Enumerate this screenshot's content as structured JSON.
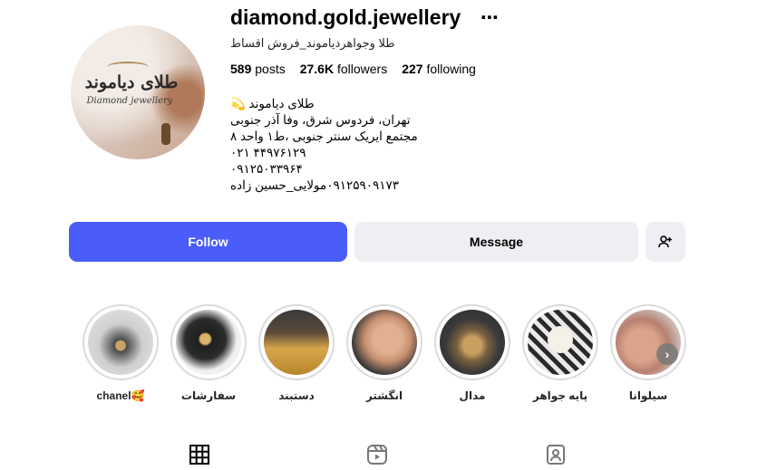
{
  "profile": {
    "username": "diamond.gold.jewellery",
    "more_icon": "⋯",
    "full_name": "طلا وجواهردیاموند_فروش اقساط",
    "avatar": {
      "logo_text": "طلای دیاموند",
      "logo_sub": "Diamond jewellery"
    },
    "stats": {
      "posts_value": "589",
      "posts_label": "posts",
      "followers_value": "27.6K",
      "followers_label": "followers",
      "following_value": "227",
      "following_label": "following"
    },
    "bio": [
      "طلای دیاموند 💫",
      "تهران، فردوس شرق، وفا آذر جنوبی",
      "مجتمع ایریک سنتر جنوبی ،ط۱ واحد ۸",
      "۰۲۱ ۴۴۹۷۶۱۲۹",
      "۰۹۱۲۵۰۳۳۹۶۴",
      "۰۹۱۲۵۹۰۹۱۷۳مولایی_حسین زاده"
    ]
  },
  "actions": {
    "follow_label": "Follow",
    "message_label": "Message",
    "add_icon": "person-plus-icon"
  },
  "highlights": [
    {
      "label": "chanel🥰"
    },
    {
      "label": "سفارشات"
    },
    {
      "label": "دستبند"
    },
    {
      "label": "انگشتر"
    },
    {
      "label": "مدال"
    },
    {
      "label": "پایه جواهر"
    },
    {
      "label": "سیلوانا"
    }
  ],
  "tabs": [
    {
      "icon": "grid-icon"
    },
    {
      "icon": "reels-icon"
    },
    {
      "icon": "tagged-icon"
    }
  ],
  "colors": {
    "follow_button": "#4a5df9",
    "secondary_button": "#efeff3"
  }
}
